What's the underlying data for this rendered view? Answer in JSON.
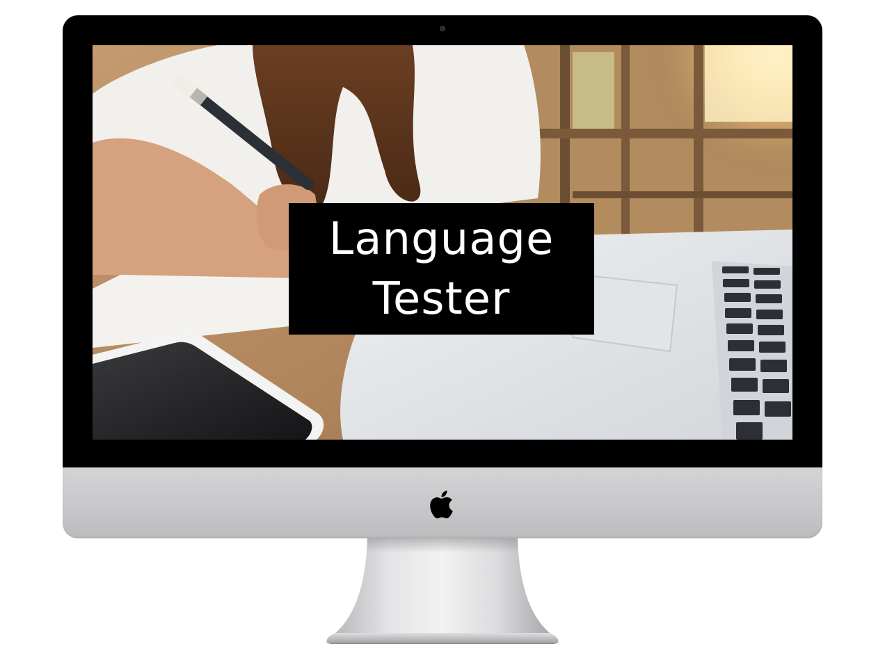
{
  "screen": {
    "title_lines": [
      "Language",
      "Tester"
    ]
  },
  "icons": {
    "brand_logo": "apple-logo-icon",
    "camera": "camera-icon"
  },
  "colors": {
    "bezel": "#000000",
    "chin": "#c8c8ca",
    "title_box": "#000000",
    "title_text": "#ffffff"
  }
}
